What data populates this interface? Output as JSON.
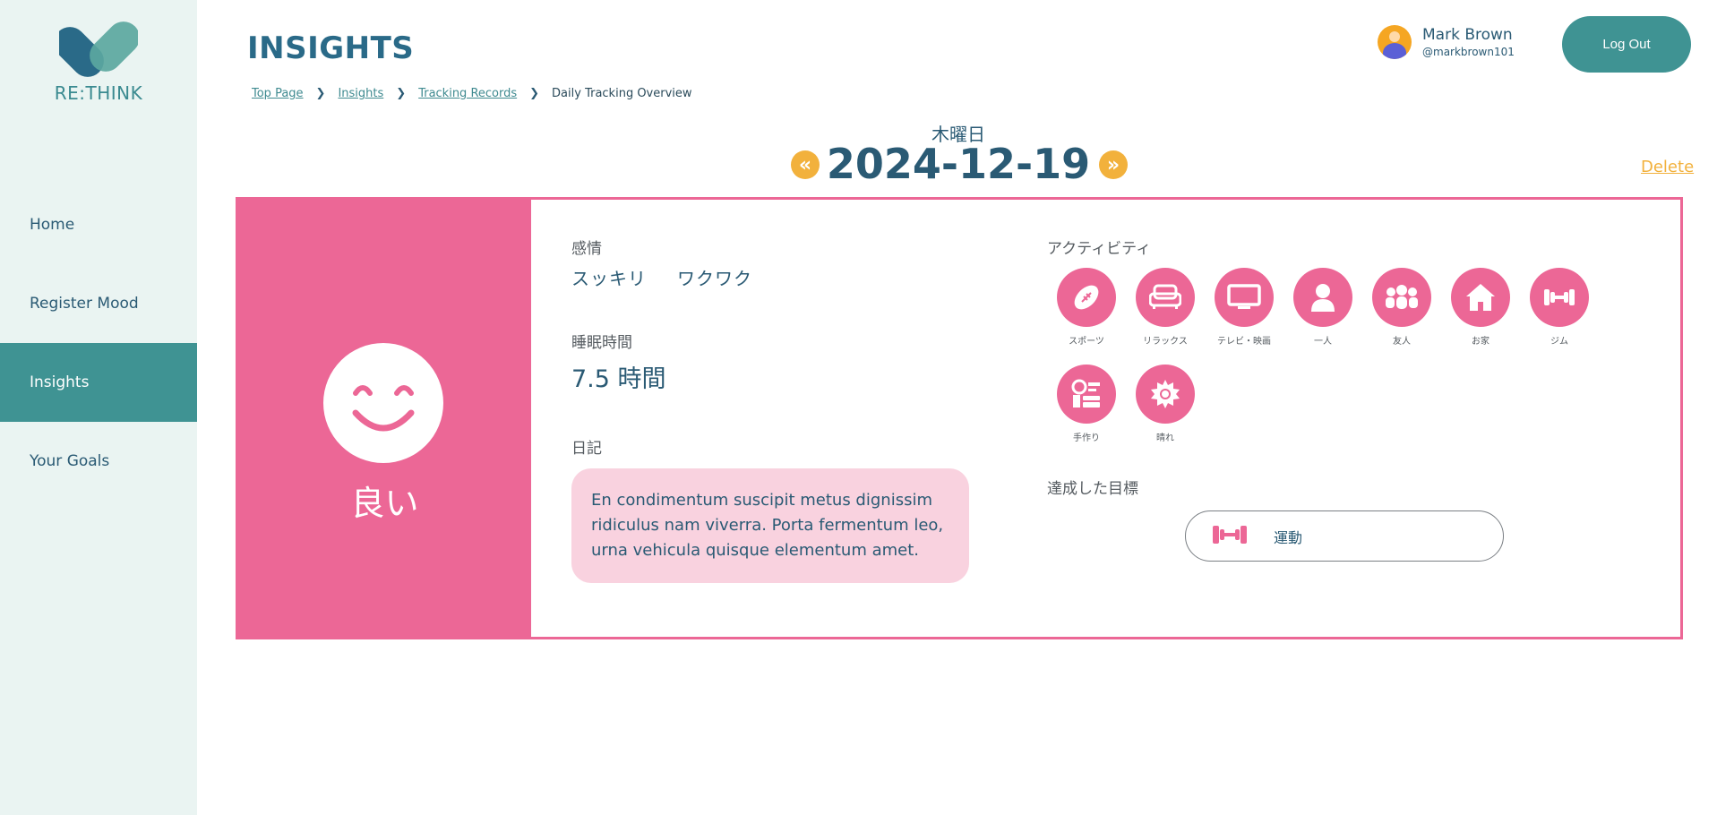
{
  "app": {
    "name": "RE:THINK",
    "brand_color": "#3f9393",
    "accent_pink": "#ec6796",
    "accent_yellow": "#f2b13c"
  },
  "sidebar": {
    "items": [
      {
        "label": "Home",
        "active": false
      },
      {
        "label": "Register Mood",
        "active": false
      },
      {
        "label": "Insights",
        "active": true
      },
      {
        "label": "Your Goals",
        "active": false
      }
    ]
  },
  "header": {
    "title": "INSIGHTS",
    "breadcrumb": [
      "Top Page",
      "Insights",
      "Tracking Records",
      "Daily Tracking Overview"
    ],
    "user": {
      "name": "Mark Brown",
      "handle": "@markbrown101"
    },
    "logout_label": "Log Out"
  },
  "date_nav": {
    "weekday": "木曜日",
    "date": "2024-12-19",
    "prev_icon": "double-chevron-left-icon",
    "next_icon": "double-chevron-right-icon",
    "delete_label": "Delete"
  },
  "record": {
    "mood": {
      "label": "良い",
      "icon": "smiling-face-icon"
    },
    "emotions_label": "感情",
    "emotions": [
      "スッキリ",
      "ワクワク"
    ],
    "sleep_label": "睡眠時間",
    "sleep_value": "7.5 時間",
    "diary_label": "日記",
    "diary_text": "En condimentum suscipit metus dignissim ridiculus nam viverra. Porta fermentum leo, urna vehicula quisque elementum amet.",
    "activities_label": "アクティビティ",
    "activities": [
      {
        "label": "スポーツ",
        "icon": "football-icon"
      },
      {
        "label": "リラックス",
        "icon": "sofa-icon"
      },
      {
        "label": "テレビ・映画",
        "icon": "tv-icon"
      },
      {
        "label": "一人",
        "icon": "person-icon"
      },
      {
        "label": "友人",
        "icon": "group-icon"
      },
      {
        "label": "お家",
        "icon": "house-icon"
      },
      {
        "label": "ジム",
        "icon": "dumbbell-icon"
      },
      {
        "label": "手作り",
        "icon": "crafting-icon"
      },
      {
        "label": "晴れ",
        "icon": "sun-icon"
      }
    ],
    "goals_label": "達成した目標",
    "goals": [
      {
        "label": "運動",
        "icon": "dumbbell-icon"
      }
    ]
  }
}
